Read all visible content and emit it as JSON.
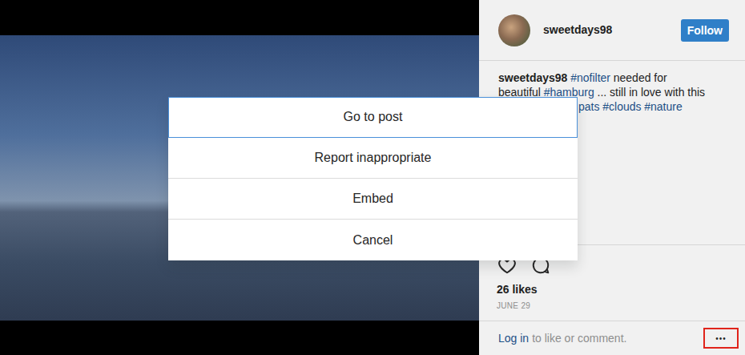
{
  "author": {
    "username": "sweetdays98",
    "follow": "Follow"
  },
  "caption": {
    "lines": [
      [
        {
          "text": "sweetdays98",
          "kind": "user"
        },
        {
          "text": "#nofilter",
          "kind": "tag"
        },
        {
          "text": "needed for",
          "kind": "text"
        }
      ],
      [
        {
          "text": "beautiful",
          "kind": "text"
        },
        {
          "text": "#hamburg",
          "kind": "tag"
        },
        {
          "text": "... still in love with this",
          "kind": "text"
        }
      ],
      [
        {
          "text": "pats",
          "kind": "tag"
        },
        {
          "text": "#clouds",
          "kind": "tag"
        },
        {
          "text": "#nature",
          "kind": "tag"
        }
      ]
    ]
  },
  "actions": {
    "liked": false
  },
  "likes": "26 likes",
  "date": "JUNE 29",
  "footer": {
    "login": "Log in",
    "text": "to like or comment.",
    "more": "•••"
  },
  "menu": {
    "items": [
      {
        "label": "Go to post",
        "selected": true
      },
      {
        "label": "Report inappropriate",
        "selected": false
      },
      {
        "label": "Embed",
        "selected": false
      },
      {
        "label": "Cancel",
        "selected": false
      }
    ]
  }
}
